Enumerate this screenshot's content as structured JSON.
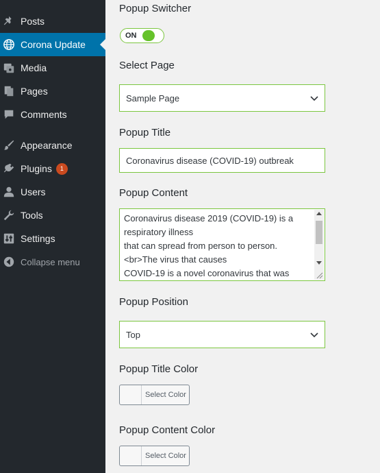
{
  "sidebar": {
    "items": [
      {
        "label": "Posts",
        "icon": "pin-icon"
      },
      {
        "label": "Corona Update",
        "icon": "globe-icon",
        "active": true
      },
      {
        "label": "Media",
        "icon": "media-icon"
      },
      {
        "label": "Pages",
        "icon": "pages-icon"
      },
      {
        "label": "Comments",
        "icon": "comment-icon"
      },
      {
        "label": "Appearance",
        "icon": "brush-icon"
      },
      {
        "label": "Plugins",
        "icon": "plug-icon",
        "badge": "1"
      },
      {
        "label": "Users",
        "icon": "user-icon"
      },
      {
        "label": "Tools",
        "icon": "wrench-icon"
      },
      {
        "label": "Settings",
        "icon": "settings-icon"
      }
    ],
    "collapse_label": "Collapse menu"
  },
  "form": {
    "switcher_label": "Popup Switcher",
    "switcher_state": "ON",
    "page_label": "Select Page",
    "page_value": "Sample Page",
    "title_label": "Popup Title",
    "title_value": "Coronavirus disease (COVID-19) outbreak",
    "content_label": "Popup Content",
    "content_value": "Coronavirus disease 2019 (COVID-19) is a respiratory illness\nthat can spread from person to person.\n<br>The virus that causes\nCOVID-19 is a novel coronavirus that was",
    "position_label": "Popup Position",
    "position_value": "Top",
    "title_color_label": "Popup Title Color",
    "title_color_button": "Select Color",
    "content_color_label": "Popup Content Color",
    "content_color_button": "Select Color"
  },
  "colors": {
    "sidebar_bg": "#23282d",
    "active_bg": "#0073aa",
    "field_border": "#7bc63f",
    "toggle_knob": "#66c22b",
    "badge": "#ca4a1f"
  }
}
